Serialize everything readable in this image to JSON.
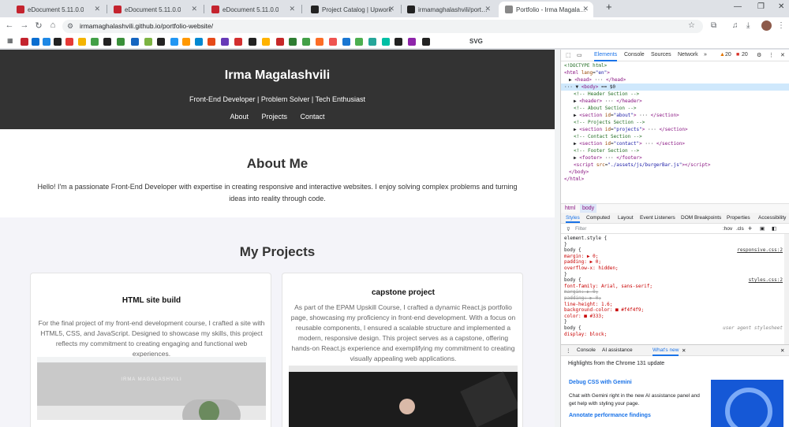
{
  "browser": {
    "tabs": [
      {
        "title": "eDocument 5.11.0.0",
        "color": "#c4232e",
        "active": false
      },
      {
        "title": "eDocument 5.11.0.0",
        "color": "#c4232e",
        "active": false
      },
      {
        "title": "eDocument 5.11.0.0",
        "color": "#c4232e",
        "active": false
      },
      {
        "title": "Project Catalog | Upwork",
        "color": "#222222",
        "active": false
      },
      {
        "title": "irmamaghalashvili/portfolio-web",
        "color": "#222222",
        "active": false
      },
      {
        "title": "Portfolio - Irma Magalashvili",
        "color": "#888888",
        "active": true
      }
    ],
    "new_tab_label": "+",
    "url": "irmamaghalashvili.github.io/portfolio-website/",
    "bookmark_svg_label": "SVG",
    "bookmark_colors": [
      "#c4232e",
      "#0a6ed1",
      "#1e88e5",
      "#222",
      "#e53935",
      "#f4b400",
      "#43a047",
      "#222",
      "#3a8f3a",
      "#1565c0",
      "#7cb342",
      "#222",
      "#2196f3",
      "#ff9800",
      "#0288d1",
      "#e64a19",
      "#673ab7",
      "#d32f2f",
      "#222",
      "#ffb300",
      "#c62828",
      "#2e7d32",
      "#43a047",
      "#fc6d26",
      "#ef5350",
      "#1976d2",
      "#4caf50",
      "#26a69a",
      "#00bfa5",
      "#222",
      "#8e24aa",
      "#222"
    ]
  },
  "site": {
    "title": "Irma Magalashvili",
    "tagline": "Front-End Developer | Problem Solver | Tech Enthusiast",
    "nav": [
      "About",
      "Projects",
      "Contact"
    ],
    "about_heading": "About Me",
    "about_text": "Hello! I'm a passionate Front-End Developer with expertise in creating responsive and interactive websites. I enjoy solving complex problems and turning ideas into reality through code.",
    "projects_heading": "My Projects",
    "projects": [
      {
        "title": "HTML site build",
        "description": "For the final project of my front-end development course, I crafted a site with HTML5, CSS, and JavaScript. Designed to showcase my skills, this project reflects my commitment to creating engaging and functional web experiences.",
        "shot_heading": "IRMA MAGALASHVILI"
      },
      {
        "title": "capstone project",
        "description": "As part of the EPAM Upskill Course, I crafted a dynamic React.js portfolio page, showcasing my proficiency in front-end development. With a focus on reusable components, I ensured a scalable structure and implemented a modern, responsive design. This project serves as a capstone, offering hands-on React.js experience and exemplifying my commitment to creating visually appealing web applications."
      }
    ]
  },
  "devtools": {
    "tabs": [
      "Elements",
      "Console",
      "Sources",
      "Network"
    ],
    "warnings": "20",
    "errors": "20",
    "dom_lines": [
      {
        "indent": 0,
        "html": "<span class='cm'>&lt;!DOCTYPE html&gt;</span>"
      },
      {
        "indent": 0,
        "html": "<span class='tg'>&lt;html</span> <span class='at'>lang</span>=<span class='av'>\"en\"</span><span class='tg'>&gt;</span>"
      },
      {
        "indent": 1,
        "html": "▶ <span class='tg'>&lt;head&gt;</span> ··· <span class='tg'>&lt;/head&gt;</span>"
      },
      {
        "indent": 0,
        "html": "··· ▼ <span class='tg'>&lt;body&gt;</span> == $0"
      },
      {
        "indent": 2,
        "html": "<span class='cm'>&lt;!-- Header Section --&gt;</span>"
      },
      {
        "indent": 2,
        "html": "▶ <span class='tg'>&lt;header&gt;</span> ··· <span class='tg'>&lt;/header&gt;</span>"
      },
      {
        "indent": 2,
        "html": "<span class='cm'>&lt;!-- About Section --&gt;</span>"
      },
      {
        "indent": 2,
        "html": "▶ <span class='tg'>&lt;section</span> <span class='at'>id</span>=<span class='av'>\"about\"</span><span class='tg'>&gt;</span> ··· <span class='tg'>&lt;/section&gt;</span>"
      },
      {
        "indent": 2,
        "html": "<span class='cm'>&lt;!-- Projects Section --&gt;</span>"
      },
      {
        "indent": 2,
        "html": "▶ <span class='tg'>&lt;section</span> <span class='at'>id</span>=<span class='av'>\"projects\"</span><span class='tg'>&gt;</span> ··· <span class='tg'>&lt;/section&gt;</span>"
      },
      {
        "indent": 2,
        "html": "<span class='cm'>&lt;!-- Contact Section --&gt;</span>"
      },
      {
        "indent": 2,
        "html": "▶ <span class='tg'>&lt;section</span> <span class='at'>id</span>=<span class='av'>\"contact\"</span><span class='tg'>&gt;</span> ··· <span class='tg'>&lt;/section&gt;</span>"
      },
      {
        "indent": 2,
        "html": "<span class='cm'>&lt;!-- Footer Section --&gt;</span>"
      },
      {
        "indent": 2,
        "html": "▶ <span class='tg'>&lt;footer&gt;</span> ··· <span class='tg'>&lt;/footer&gt;</span>"
      },
      {
        "indent": 2,
        "html": "<span class='tg'>&lt;script</span> <span class='at'>src</span>=<span class='av'>\"./assets/js/burgerBar.js\"</span><span class='tg'>&gt;&lt;/script&gt;</span>"
      },
      {
        "indent": 1,
        "html": "<span class='tg'>&lt;/body&gt;</span>"
      },
      {
        "indent": 0,
        "html": "<span class='tg'>&lt;/html&gt;</span>"
      }
    ],
    "crumbs": [
      "html",
      "body"
    ],
    "style_tabs": [
      "Styles",
      "Computed",
      "Layout",
      "Event Listeners",
      "DOM Breakpoints",
      "Properties",
      "Accessibility"
    ],
    "filter_placeholder": "Filter",
    "filter_tools": [
      ":hov",
      ".cls",
      "+"
    ],
    "rules": [
      {
        "t": "element.style {",
        "s": ""
      },
      {
        "t": "}",
        "s": ""
      },
      {
        "t": "body {",
        "s": "responsive.css:2"
      },
      {
        "t": "  margin: ▶ 0;",
        "s": ""
      },
      {
        "t": "  padding: ▶ 0;",
        "s": ""
      },
      {
        "t": "  overflow-x: hidden;",
        "s": ""
      },
      {
        "t": "}",
        "s": ""
      },
      {
        "t": "body {",
        "s": "styles.css:2"
      },
      {
        "t": "  font-family: Arial, sans-serif;",
        "s": ""
      },
      {
        "t": "  margin: ▶ 0;",
        "s": "",
        "strike": true
      },
      {
        "t": "  padding: ▶ 0;",
        "s": "",
        "strike": true
      },
      {
        "t": "  line-height: 1.6;",
        "s": ""
      },
      {
        "t": "  background-color: ■ #f4f4f9;",
        "s": ""
      },
      {
        "t": "  color: ■ #333;",
        "s": ""
      },
      {
        "t": "}",
        "s": ""
      },
      {
        "t": "body {",
        "s": "user agent stylesheet"
      },
      {
        "t": "  display: block;",
        "s": ""
      }
    ],
    "drawer_tabs": [
      "Console",
      "AI assistance",
      "What's new"
    ],
    "drawer": {
      "intro": "Highlights from the Chrome 131 update",
      "h1": "Debug CSS with Gemini",
      "p1": "Chat with Gemini right in the new AI assistance panel and get help with styling your page.",
      "h2": "Annotate performance findings"
    }
  }
}
